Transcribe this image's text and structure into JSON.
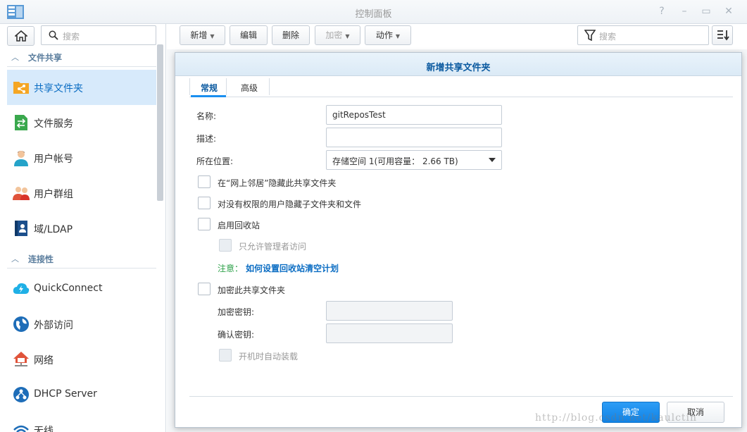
{
  "window": {
    "title": "控制面板"
  },
  "sidebar": {
    "search_placeholder": "搜索",
    "sections": [
      {
        "label": "文件共享"
      },
      {
        "label": "连接性"
      }
    ],
    "items": [
      {
        "label": "共享文件夹",
        "icon": "shared-folder-icon",
        "active": true
      },
      {
        "label": "文件服务",
        "icon": "file-services-icon"
      },
      {
        "label": "用户帐号",
        "icon": "user-icon"
      },
      {
        "label": "用户群组",
        "icon": "group-icon"
      },
      {
        "label": "域/LDAP",
        "icon": "directory-icon"
      },
      {
        "label": "QuickConnect",
        "icon": "quickconnect-icon"
      },
      {
        "label": "外部访问",
        "icon": "external-access-icon"
      },
      {
        "label": "网络",
        "icon": "network-icon"
      },
      {
        "label": "DHCP Server",
        "icon": "dhcp-icon"
      },
      {
        "label": "无线",
        "icon": "wireless-icon"
      }
    ]
  },
  "toolbar": {
    "create": "新增",
    "edit": "编辑",
    "delete": "删除",
    "encrypt": "加密",
    "action": "动作",
    "search_placeholder": "搜索"
  },
  "dialog": {
    "title": "新增共享文件夹",
    "tabs": [
      {
        "label": "常规",
        "active": true
      },
      {
        "label": "高级"
      }
    ],
    "fields": {
      "name_label": "名称:",
      "name_value": "gitReposTest",
      "desc_label": "描述:",
      "desc_value": "",
      "location_label": "所在位置:",
      "location_value": "存储空间 1(可用容量： 2.66 TB)"
    },
    "checkboxes": {
      "hide_network": "在“网上邻居”隐藏此共享文件夹",
      "hide_subfolders": "对没有权限的用户隐藏子文件夹和文件",
      "recycle_bin": "启用回收站",
      "admin_only": "只允许管理者访问",
      "encrypt": "加密此共享文件夹",
      "automount": "开机时自动装载"
    },
    "note": {
      "label": "注意：",
      "link": "如何设置回收站清空计划"
    },
    "encrypt_key_label": "加密密钥:",
    "confirm_key_label": "确认密钥:",
    "ok": "确定",
    "cancel": "取消"
  },
  "watermark": "http://blog.csdn.net/kaulctin",
  "colors": {
    "accent": "#1a8ff0",
    "active_bg": "#d7eafb",
    "note_green": "#2ea14a"
  }
}
